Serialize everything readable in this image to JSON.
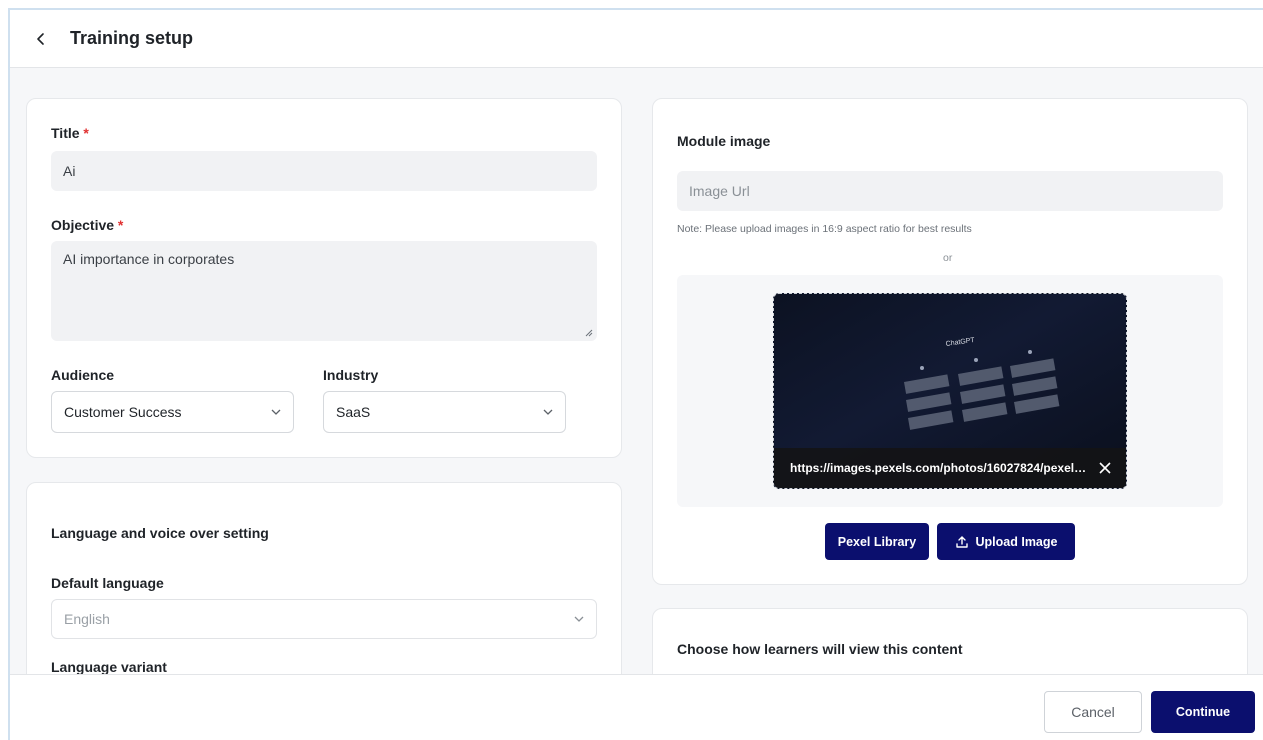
{
  "header": {
    "title": "Training setup"
  },
  "basics": {
    "title_label": "Title",
    "title_value": "Ai",
    "objective_label": "Objective",
    "objective_value": "AI importance in corporates",
    "required_mark": "*",
    "audience_label": "Audience",
    "audience_value": "Customer Success",
    "industry_label": "Industry",
    "industry_value": "SaaS"
  },
  "language": {
    "section_title": "Language and voice over setting",
    "default_language_label": "Default language",
    "default_language_value": "English",
    "variant_label": "Language variant"
  },
  "module_image": {
    "section_title": "Module image",
    "url_placeholder": "Image Url",
    "note": "Note: Please upload images in 16:9 aspect ratio for best results",
    "or": "or",
    "preview_url": "https://images.pexels.com/photos/16027824/pexel…",
    "preview_caption": "ChatGPT",
    "pexel_button": "Pexel Library",
    "upload_button": "Upload Image"
  },
  "view_mode": {
    "section_title": "Choose how learners will view this content"
  },
  "footer": {
    "cancel": "Cancel",
    "continue": "Continue"
  },
  "colors": {
    "primary": "#0b0f6e",
    "required": "#e03131",
    "input_bg": "#f1f2f4"
  }
}
